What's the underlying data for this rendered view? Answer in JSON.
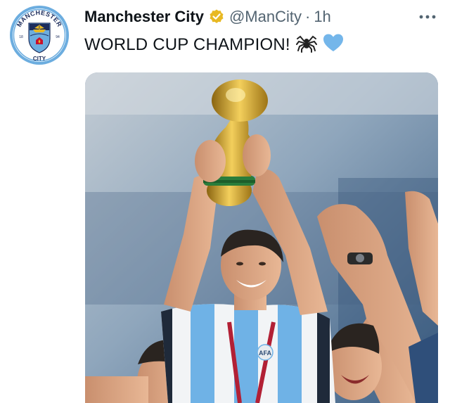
{
  "account": {
    "display_name": "Manchester City",
    "handle": "@ManCity",
    "separator": "·",
    "timestamp": "1h",
    "verified_color": "#e8b923",
    "avatar_badge": {
      "top_text": "MANCHESTER",
      "bottom_text": "CITY",
      "left_year": "18",
      "right_year": "94",
      "badge_color": "#6caddf",
      "navy": "#1c2c5b"
    }
  },
  "tweet": {
    "text": "WORLD CUP CHAMPION!",
    "emojis": [
      "spider-emoji",
      "light-blue-heart-emoji"
    ]
  },
  "media": {
    "type": "photo",
    "jersey_text": "AFA"
  },
  "icons": {
    "more": "more-horizontal-icon",
    "verified": "verified-badge-icon"
  }
}
